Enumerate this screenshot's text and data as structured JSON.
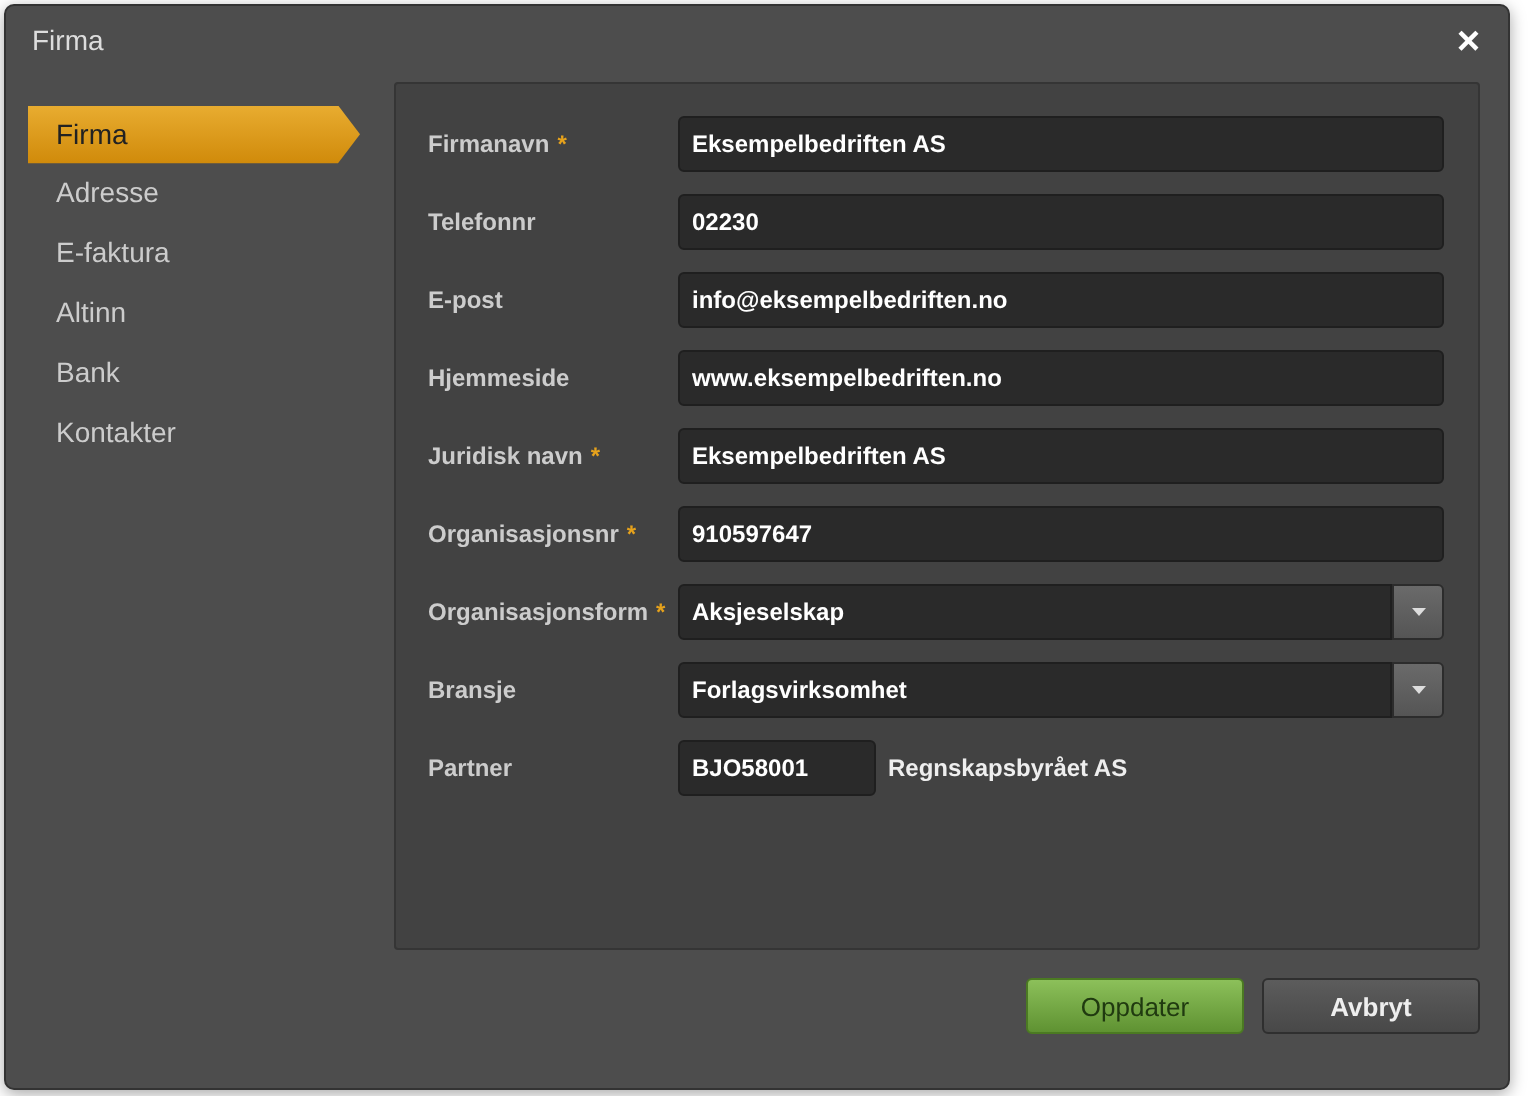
{
  "window": {
    "title": "Firma",
    "close": "×"
  },
  "sidebar": {
    "items": [
      {
        "label": "Firma",
        "selected": true
      },
      {
        "label": "Adresse",
        "selected": false
      },
      {
        "label": "E-faktura",
        "selected": false
      },
      {
        "label": "Altinn",
        "selected": false
      },
      {
        "label": "Bank",
        "selected": false
      },
      {
        "label": "Kontakter",
        "selected": false
      }
    ]
  },
  "form": {
    "fields": [
      {
        "kind": "input",
        "label": "Firmanavn",
        "required_mark": "*",
        "value": "Eksempelbedriften AS"
      },
      {
        "kind": "input",
        "label": "Telefonnr",
        "value": "02230"
      },
      {
        "kind": "input",
        "label": "E-post",
        "value": "info@eksempelbedriften.no"
      },
      {
        "kind": "input",
        "label": "Hjemmeside",
        "value": "www.eksempelbedriften.no"
      },
      {
        "kind": "input",
        "label": "Juridisk navn",
        "required_mark": "*",
        "value": "Eksempelbedriften AS"
      },
      {
        "kind": "input",
        "label": "Organisasjonsnr",
        "required_mark": "*",
        "value": "910597647"
      },
      {
        "kind": "select",
        "label": "Organisasjonsform",
        "required_mark": "*",
        "value": "Aksjeselskap"
      },
      {
        "kind": "select",
        "label": "Bransje",
        "value": "Forlagsvirksomhet"
      },
      {
        "kind": "partner",
        "label": "Partner",
        "value": "BJO58001",
        "note": "Regnskapsbyrået AS"
      }
    ]
  },
  "buttons": [
    {
      "label": "Oppdater",
      "kind": "primary"
    },
    {
      "label": "Avbryt",
      "kind": "secondary"
    }
  ]
}
